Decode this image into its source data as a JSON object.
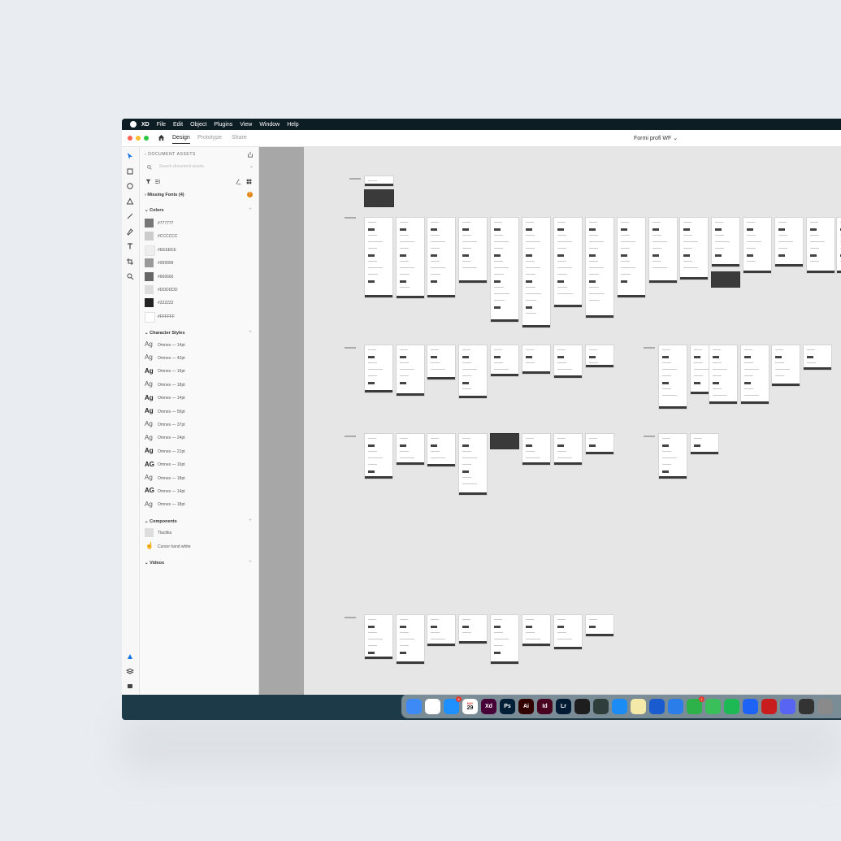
{
  "menubar": {
    "app": "XD",
    "items": [
      "File",
      "Edit",
      "Object",
      "Plugins",
      "View",
      "Window",
      "Help"
    ]
  },
  "window": {
    "tabs": [
      "Design",
      "Prototype",
      "Share"
    ],
    "active_tab": "Design",
    "document_title": "Formi profi WF",
    "traffic_colors": [
      "#fe5f57",
      "#febc2e",
      "#28c840"
    ]
  },
  "assets": {
    "header": "DOCUMENT ASSETS",
    "search_placeholder": "Search document assets",
    "missing_fonts": "Missing Fonts (4)",
    "colors_title": "Colors",
    "colors": [
      {
        "hex": "#777777",
        "label": "#777777"
      },
      {
        "hex": "#CCCCCC",
        "label": "#CCCCCC"
      },
      {
        "hex": "#EEEEEE",
        "label": "#EEEEEE"
      },
      {
        "hex": "#999999",
        "label": "#999999"
      },
      {
        "hex": "#666666",
        "label": "#666666"
      },
      {
        "hex": "#DDDDDD",
        "label": "#DDDDDD"
      },
      {
        "hex": "#222222",
        "label": "#222222"
      },
      {
        "hex": "#FFFFFF",
        "label": "#FFFFFF"
      }
    ],
    "char_title": "Character Styles",
    "char_styles": [
      {
        "ag": "Ag",
        "label": "Omnes — 14pt"
      },
      {
        "ag": "Ag",
        "label": "Omnes — 42pt"
      },
      {
        "ag": "Ag",
        "label": "Omnes — 16pt"
      },
      {
        "ag": "Ag",
        "label": "Omnes — 18pt"
      },
      {
        "ag": "Ag",
        "label": "Omnes — 14pt"
      },
      {
        "ag": "Ag",
        "label": "Omnes — 56pt"
      },
      {
        "ag": "Ag",
        "label": "Omnes — 37pt"
      },
      {
        "ag": "Ag",
        "label": "Omnes — 24pt"
      },
      {
        "ag": "Ag",
        "label": "Omnes — 21pt"
      },
      {
        "ag": "AG",
        "label": "Omnes — 16pt"
      },
      {
        "ag": "Ag",
        "label": "Omnes — 18pt"
      },
      {
        "ag": "AG",
        "label": "Omnes — 14pt"
      },
      {
        "ag": "Ag",
        "label": "Omnes — 18pt"
      }
    ],
    "components_title": "Components",
    "components": [
      "Tlacitka",
      "Cursor hand white"
    ],
    "videos_title": "Videos"
  },
  "dock": {
    "apps": [
      {
        "name": "finder",
        "text": "",
        "color": "#3d8af7"
      },
      {
        "name": "chrome",
        "text": "",
        "color": "#ffffff"
      },
      {
        "name": "app-store",
        "text": "",
        "color": "#1e90ff",
        "badge": "8"
      },
      {
        "name": "calendar",
        "text": "29",
        "color": "#ffffff",
        "month": "MAY"
      },
      {
        "name": "xd",
        "text": "Xd",
        "color": "#470137"
      },
      {
        "name": "photoshop",
        "text": "Ps",
        "color": "#001e36"
      },
      {
        "name": "illustrator",
        "text": "Ai",
        "color": "#330000"
      },
      {
        "name": "indesign",
        "text": "Id",
        "color": "#49021f"
      },
      {
        "name": "lightroom",
        "text": "Lr",
        "color": "#001a33"
      },
      {
        "name": "figma",
        "text": "",
        "color": "#1e1e1e"
      },
      {
        "name": "affinity",
        "text": "",
        "color": "#2e3e3a"
      },
      {
        "name": "framer",
        "text": "",
        "color": "#1c8cf5"
      },
      {
        "name": "notes",
        "text": "",
        "color": "#f4e9a8"
      },
      {
        "name": "1password",
        "text": "",
        "color": "#1a5bd0"
      },
      {
        "name": "tasks",
        "text": "",
        "color": "#2b7de9"
      },
      {
        "name": "facetime",
        "text": "",
        "color": "#2db24a",
        "badge": "1"
      },
      {
        "name": "messages",
        "text": "",
        "color": "#3ac05a"
      },
      {
        "name": "spotify",
        "text": "",
        "color": "#1db954"
      },
      {
        "name": "dropbox",
        "text": "",
        "color": "#1d63f5"
      },
      {
        "name": "acrobat",
        "text": "",
        "color": "#c91d1d"
      },
      {
        "name": "discord",
        "text": "",
        "color": "#5865f2"
      },
      {
        "name": "calculator",
        "text": "",
        "color": "#333333"
      },
      {
        "name": "settings",
        "text": "",
        "color": "#8a8a8a"
      }
    ]
  }
}
